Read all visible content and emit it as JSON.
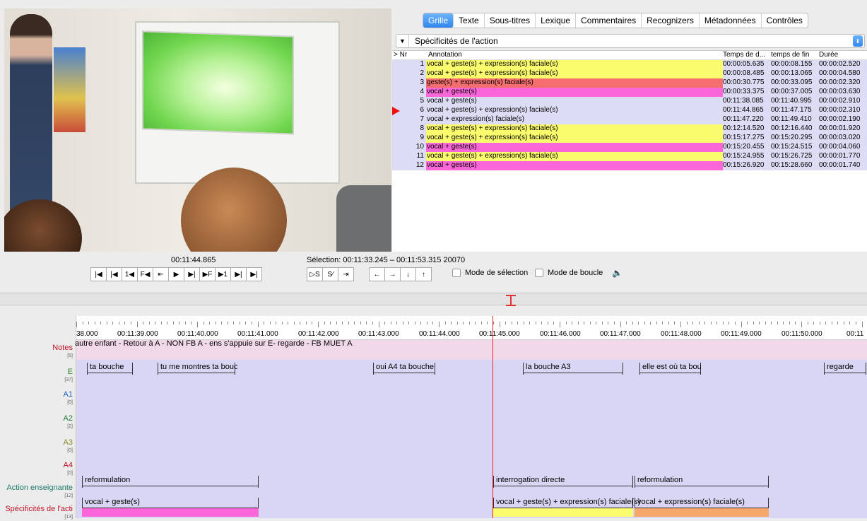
{
  "tabs": [
    "Grille",
    "Texte",
    "Sous-titres",
    "Lexique",
    "Commentaires",
    "Recognizers",
    "Métadonnées",
    "Contrôles"
  ],
  "active_tab": "Grille",
  "tier_selector": "Spécificités de l'action",
  "grid": {
    "headers": {
      "nr": "> Nr",
      "annotation": "Annotation",
      "start": "Temps de d...",
      "end": "temps de fin",
      "duration": "Durée"
    },
    "current_row": 6,
    "colors": {
      "yellow": "#fbfb6e",
      "red": "#f46e6e",
      "pink": "#fb66d8"
    },
    "rows": [
      {
        "nr": "1",
        "annotation": "vocal + geste(s) + expression(s) faciale(s)",
        "start": "00:00:05.635",
        "end": "00:00:08.155",
        "duration": "00:00:02.520",
        "color": "#fbfb6e"
      },
      {
        "nr": "2",
        "annotation": "vocal + geste(s) + expression(s) faciale(s)",
        "start": "00:00:08.485",
        "end": "00:00:13.065",
        "duration": "00:00:04.580",
        "color": "#fbfb6e"
      },
      {
        "nr": "3",
        "annotation": "geste(s) + expression(s) faciale(s)",
        "start": "00:00:30.775",
        "end": "00:00:33.095",
        "duration": "00:00:02.320",
        "color": "#f46e6e"
      },
      {
        "nr": "4",
        "annotation": "vocal + geste(s)",
        "start": "00:00:33.375",
        "end": "00:00:37.005",
        "duration": "00:00:03.630",
        "color": "#fb66d8"
      },
      {
        "nr": "5",
        "annotation": "vocal + geste(s)",
        "start": "00:11:38.085",
        "end": "00:11:40.995",
        "duration": "00:00:02.910",
        "color": "#dcdcf4"
      },
      {
        "nr": "6",
        "annotation": "vocal + geste(s) + expression(s) faciale(s)",
        "start": "00:11:44.865",
        "end": "00:11:47.175",
        "duration": "00:00:02.310",
        "color": "#dcdcf4"
      },
      {
        "nr": "7",
        "annotation": "vocal + expression(s) faciale(s)",
        "start": "00:11:47.220",
        "end": "00:11:49.410",
        "duration": "00:00:02.190",
        "color": "#dcdcf4"
      },
      {
        "nr": "8",
        "annotation": "vocal + geste(s) + expression(s) faciale(s)",
        "start": "00:12:14.520",
        "end": "00:12:16.440",
        "duration": "00:00:01.920",
        "color": "#fbfb6e"
      },
      {
        "nr": "9",
        "annotation": "vocal + geste(s) + expression(s) faciale(s)",
        "start": "00:15:17.275",
        "end": "00:15:20.295",
        "duration": "00:00:03.020",
        "color": "#fbfb6e"
      },
      {
        "nr": "10",
        "annotation": "vocal + geste(s)",
        "start": "00:15:20.455",
        "end": "00:15:24.515",
        "duration": "00:00:04.060",
        "color": "#fb66d8"
      },
      {
        "nr": "11",
        "annotation": "vocal + geste(s) + expression(s) faciale(s)",
        "start": "00:15:24.955",
        "end": "00:15:26.725",
        "duration": "00:00:01.770",
        "color": "#fbfb6e"
      },
      {
        "nr": "12",
        "annotation": "vocal + geste(s)",
        "start": "00:15:26.920",
        "end": "00:15:28.660",
        "duration": "00:00:01.740",
        "color": "#fb66d8"
      }
    ]
  },
  "media": {
    "timecode": "00:11:44.865",
    "selection": "Sélection: 00:11:33.245 – 00:11:53.315  20070",
    "transport_buttons": [
      "|◀",
      "|◀",
      "1◀",
      "F◀",
      "⇤",
      "▶",
      "▶|",
      "▶F",
      "▶1",
      "▶|",
      "▶|"
    ],
    "selection_buttons": [
      "▷S",
      "S⁄",
      "⇥"
    ],
    "nav_buttons": [
      "←",
      "→",
      "↓",
      "↑"
    ],
    "selection_mode": "Mode de sélection",
    "loop_mode": "Mode de boucle"
  },
  "timeline": {
    "ruler_ticks": [
      "38.000",
      "00:11:39.000",
      "00:11:40.000",
      "00:11:41.000",
      "00:11:42.000",
      "00:11:43.000",
      "00:11:44.000",
      "00:11:45.000",
      "00:11:46.000",
      "00:11:47.000",
      "00:11:48.000",
      "00:11:49.000",
      "00:11:50.000",
      "00:11"
    ],
    "tiers": [
      {
        "name": "Notes",
        "count": "[5]",
        "color": "#c0142a"
      },
      {
        "name": "E",
        "count": "[37]",
        "color": "#2d8c2d"
      },
      {
        "name": "A1",
        "count": "[0]",
        "color": "#1f5fbf"
      },
      {
        "name": "A2",
        "count": "[2]",
        "color": "#1d7a3a"
      },
      {
        "name": "A3",
        "count": "[0]",
        "color": "#8a8a2a"
      },
      {
        "name": "A4",
        "count": "[0]",
        "color": "#c0142a"
      },
      {
        "name": "Action enseignante",
        "count": "[12]",
        "color": "#1d7a6a"
      },
      {
        "name": "Spécificités de l'acti",
        "count": "[13]",
        "color": "#c0142a"
      }
    ],
    "notes_text": "autre enfant - Retour à A -   NON FB A - ens s'appuie sur E- regarde - FB MUET A",
    "e_segments": [
      "ta bouche",
      "tu me montres ta bouc",
      "oui A4 ta bouche",
      "la bouche A3",
      "elle est où ta bou",
      "regarde"
    ],
    "action_segments": [
      "reformulation",
      "interrogation directe",
      "reformulation"
    ],
    "spec_segments": [
      "vocal + geste(s)",
      "vocal + geste(s) + expression(s) faciale(s)",
      "vocal + expression(s) faciale(s)"
    ]
  }
}
